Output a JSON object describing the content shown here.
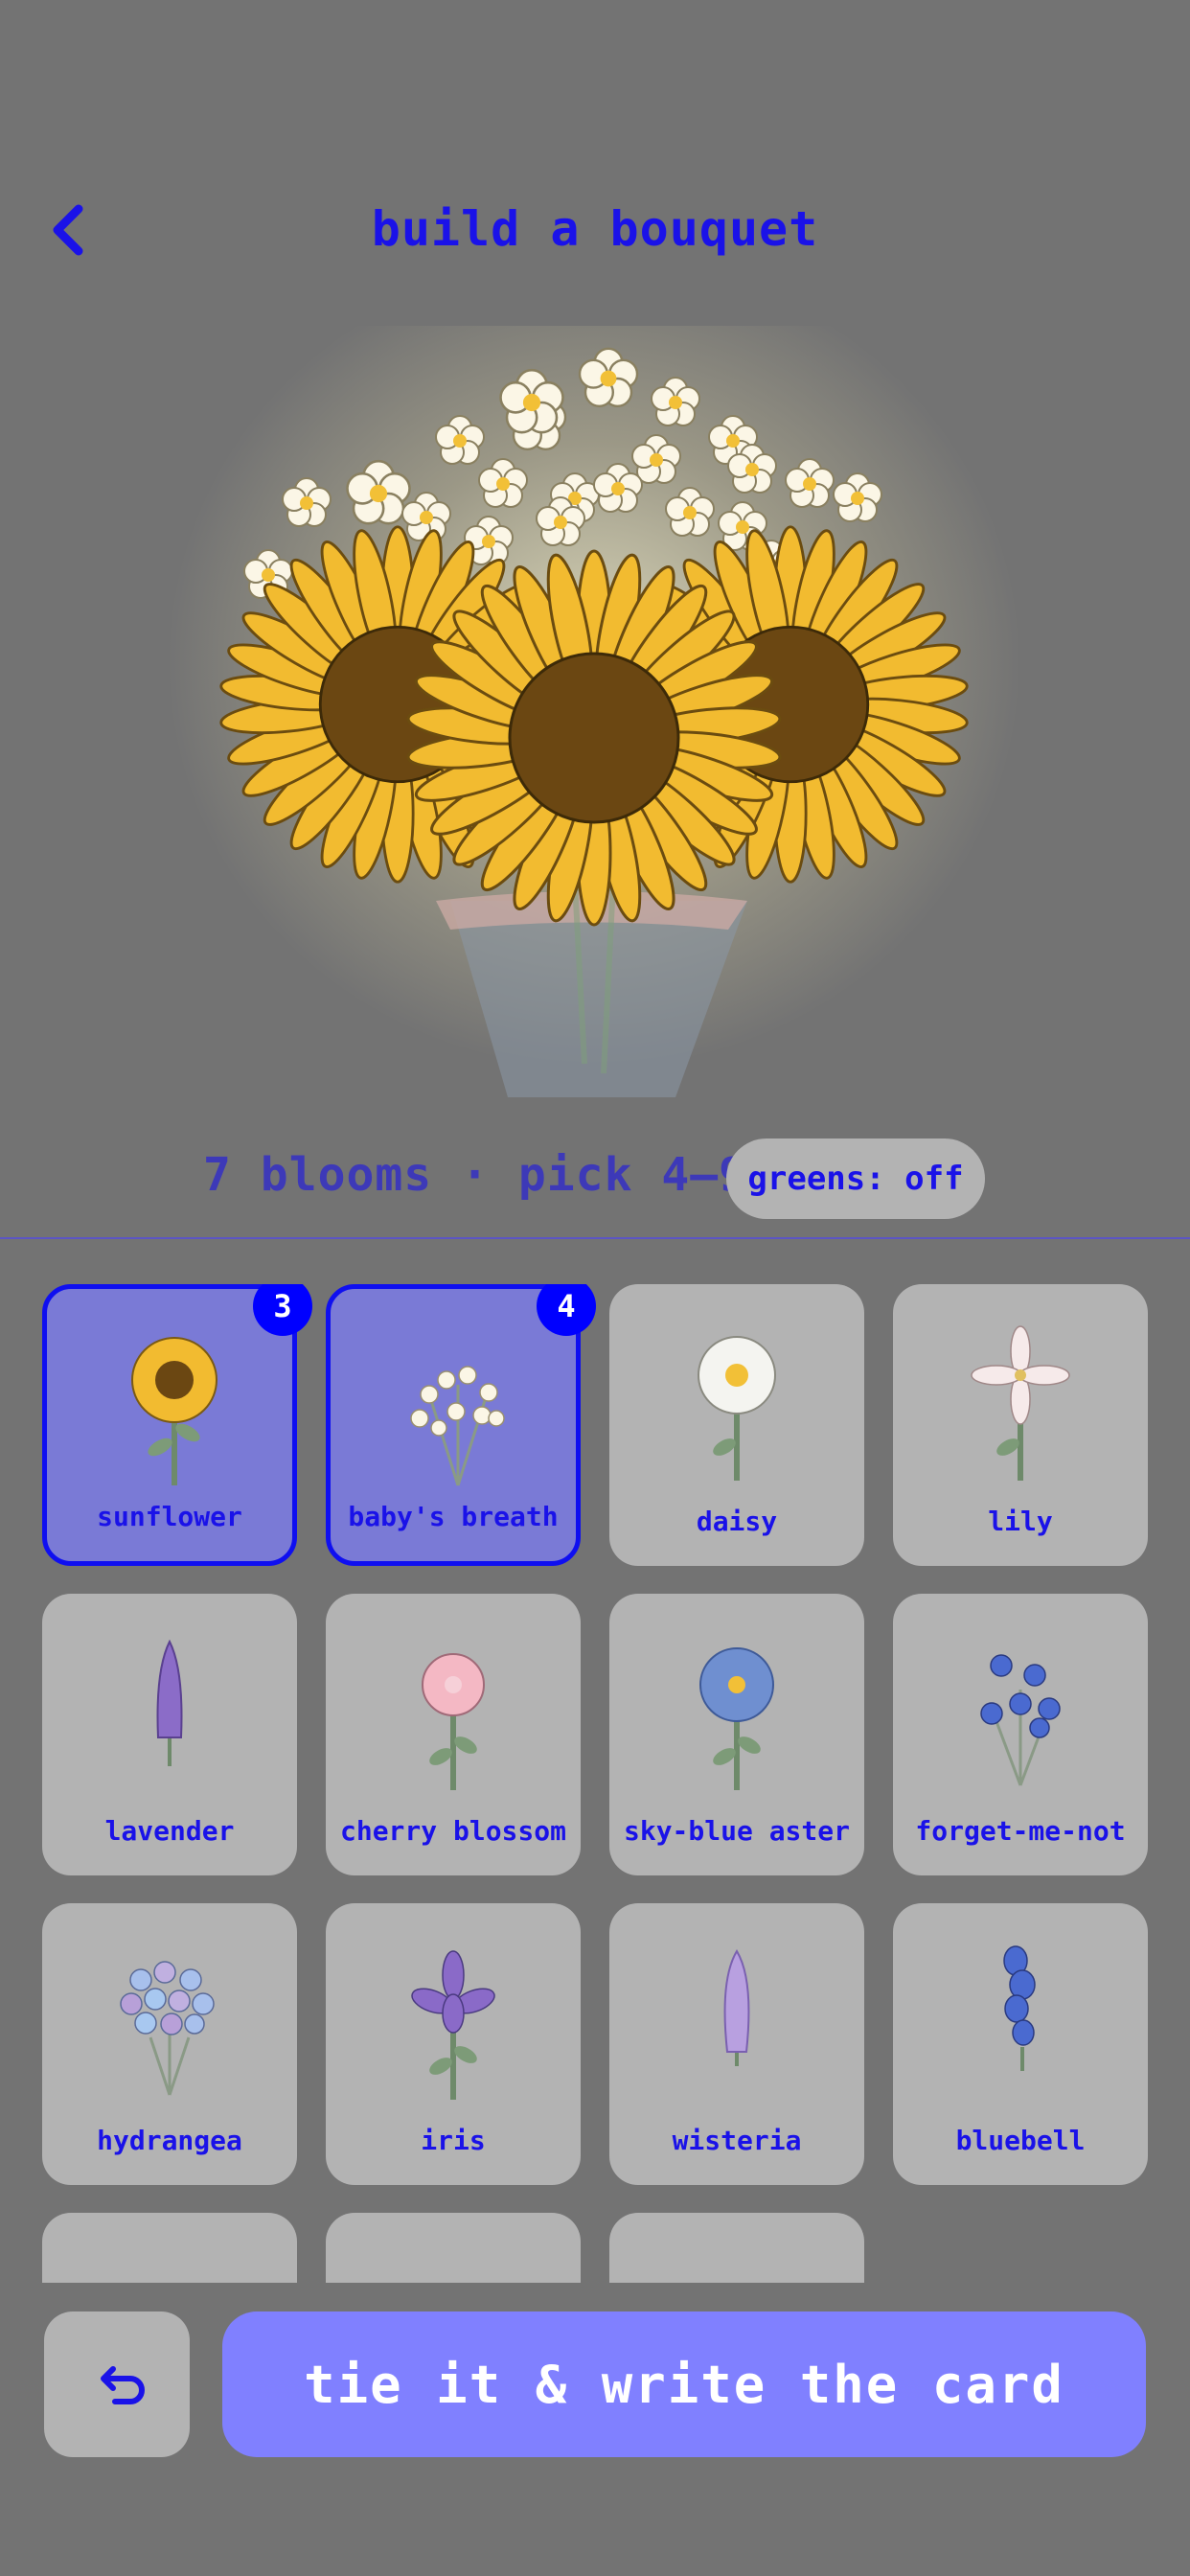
{
  "header": {
    "title": "build a bouquet",
    "back_icon": "chevron-left-icon"
  },
  "status": {
    "count_text": "7 blooms · pick 4–9",
    "greens_label": "greens: off"
  },
  "flowers": [
    {
      "label": "sunflower",
      "selected": true,
      "count": "3"
    },
    {
      "label": "baby's breath",
      "selected": true,
      "count": "4"
    },
    {
      "label": "daisy",
      "selected": false
    },
    {
      "label": "lily",
      "selected": false
    },
    {
      "label": "lavender",
      "selected": false
    },
    {
      "label": "cherry blossom",
      "selected": false
    },
    {
      "label": "sky-blue aster",
      "selected": false
    },
    {
      "label": "forget-me-not",
      "selected": false
    },
    {
      "label": "hydrangea",
      "selected": false
    },
    {
      "label": "iris",
      "selected": false
    },
    {
      "label": "wisteria",
      "selected": false
    },
    {
      "label": "bluebell",
      "selected": false
    },
    {
      "label": "",
      "selected": false
    },
    {
      "label": "",
      "selected": false
    },
    {
      "label": "",
      "selected": false
    }
  ],
  "actions": {
    "undo_icon": "undo-icon",
    "primary_label": "tie it & write the card"
  },
  "colors": {
    "accent": "#1a12e8",
    "selected_tile": "#7a7ad6",
    "primary_button": "#8080ff",
    "background": "#737373"
  }
}
